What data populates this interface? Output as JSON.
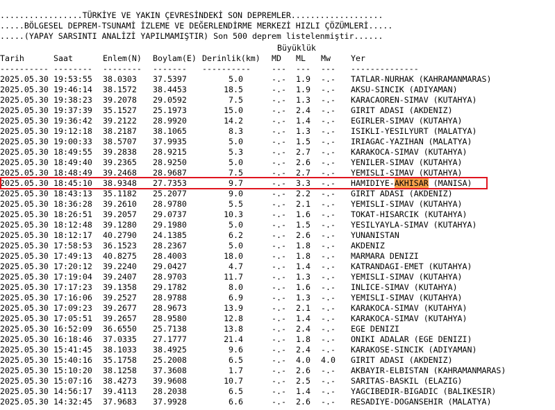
{
  "header": {
    "line1": ".................TÜRKİYE VE YAKIN ÇEVRESİNDEKİ SON DEPREMLER...................",
    "line2": ".....BÖLGESEL DEPREM-TSUNAMİ İZLEME VE DEĞERLENDİRME MERKEZİ HIZLI ÇÖZÜMLERİ.....",
    "line3": ".....(YAPAY SARSINTI ANALİZİ YAPILMAMIŞTIR) Son 500 deprem listelenmiştir......"
  },
  "columns": {
    "magnitude_group": "Büyüklük",
    "date": "Tarih",
    "time": "Saat",
    "lat": "Enlem(N)",
    "lon": "Boylam(E)",
    "depth": "Derinlik(km)",
    "md": "MD",
    "ml": "ML",
    "mw": "Mw",
    "place": "Yer"
  },
  "separators": {
    "date": "----------",
    "time": "--------",
    "lat": "--------",
    "lon": "-------",
    "depth": "----------",
    "md": "---",
    "ml": "---",
    "mw": "---",
    "place": "--------------"
  },
  "highlight": {
    "row_index": 10,
    "term": "AKHISAR",
    "mark_color": "#f5a04a",
    "box_color": "#e0141e"
  },
  "rows": [
    {
      "date": "2025.05.30",
      "time": "19:53:55",
      "lat": "38.0303",
      "lon": "37.5397",
      "depth": "5.0",
      "md": "-.-",
      "ml": "1.9",
      "mw": "-.-",
      "place": "TATLAR-NURHAK (KAHRAMANMARAS)"
    },
    {
      "date": "2025.05.30",
      "time": "19:46:14",
      "lat": "38.1572",
      "lon": "38.4453",
      "depth": "18.5",
      "md": "-.-",
      "ml": "1.9",
      "mw": "-.-",
      "place": "AKSU-SINCIK (ADIYAMAN)"
    },
    {
      "date": "2025.05.30",
      "time": "19:38:23",
      "lat": "39.2078",
      "lon": "29.0592",
      "depth": "7.5",
      "md": "-.-",
      "ml": "1.3",
      "mw": "-.-",
      "place": "KARACAOREN-SIMAV (KUTAHYA)"
    },
    {
      "date": "2025.05.30",
      "time": "19:37:39",
      "lat": "35.1527",
      "lon": "25.1973",
      "depth": "15.0",
      "md": "-.-",
      "ml": "2.4",
      "mw": "-.-",
      "place": "GIRIT ADASI (AKDENIZ)"
    },
    {
      "date": "2025.05.30",
      "time": "19:36:42",
      "lat": "39.2122",
      "lon": "28.9920",
      "depth": "14.2",
      "md": "-.-",
      "ml": "1.4",
      "mw": "-.-",
      "place": "EGIRLER-SIMAV (KUTAHYA)"
    },
    {
      "date": "2025.05.30",
      "time": "19:12:18",
      "lat": "38.2187",
      "lon": "38.1065",
      "depth": "8.3",
      "md": "-.-",
      "ml": "1.3",
      "mw": "-.-",
      "place": "ISIKLI-YESILYURT (MALATYA)"
    },
    {
      "date": "2025.05.30",
      "time": "19:00:33",
      "lat": "38.5707",
      "lon": "37.9935",
      "depth": "5.0",
      "md": "-.-",
      "ml": "1.5",
      "mw": "-.-",
      "place": "IRIAGAC-YAZIHAN (MALATYA)"
    },
    {
      "date": "2025.05.30",
      "time": "18:49:55",
      "lat": "39.2838",
      "lon": "28.9215",
      "depth": "5.3",
      "md": "-.-",
      "ml": "2.7",
      "mw": "-.-",
      "place": "KARAKOCA-SIMAV (KUTAHYA)"
    },
    {
      "date": "2025.05.30",
      "time": "18:49:40",
      "lat": "39.2365",
      "lon": "28.9250",
      "depth": "5.0",
      "md": "-.-",
      "ml": "2.6",
      "mw": "-.-",
      "place": "YENILER-SIMAV (KUTAHYA)"
    },
    {
      "date": "2025.05.30",
      "time": "18:48:49",
      "lat": "39.2468",
      "lon": "28.9687",
      "depth": "7.5",
      "md": "-.-",
      "ml": "2.7",
      "mw": "-.-",
      "place": "YEMISLI-SIMAV (KUTAHYA)"
    },
    {
      "date": "2025.05.30",
      "time": "18:45:10",
      "lat": "38.9348",
      "lon": "27.7353",
      "depth": "9.7",
      "md": "-.-",
      "ml": "3.3",
      "mw": "-.-",
      "place": "HAMIDIYE-AKHISAR (MANISA)"
    },
    {
      "date": "2025.05.30",
      "time": "18:43:13",
      "lat": "35.1182",
      "lon": "25.2077",
      "depth": "9.0",
      "md": "-.-",
      "ml": "2.2",
      "mw": "-.-",
      "place": "GIRIT ADASI (AKDENIZ)"
    },
    {
      "date": "2025.05.30",
      "time": "18:36:28",
      "lat": "39.2610",
      "lon": "28.9780",
      "depth": "5.5",
      "md": "-.-",
      "ml": "2.1",
      "mw": "-.-",
      "place": "YEMISLI-SIMAV (KUTAHYA)"
    },
    {
      "date": "2025.05.30",
      "time": "18:26:51",
      "lat": "39.2057",
      "lon": "29.0737",
      "depth": "10.3",
      "md": "-.-",
      "ml": "1.6",
      "mw": "-.-",
      "place": "TOKAT-HISARCIK (KUTAHYA)"
    },
    {
      "date": "2025.05.30",
      "time": "18:12:48",
      "lat": "39.1280",
      "lon": "29.1980",
      "depth": "5.0",
      "md": "-.-",
      "ml": "1.5",
      "mw": "-.-",
      "place": "YESILYAYLA-SIMAV (KUTAHYA)"
    },
    {
      "date": "2025.05.30",
      "time": "18:12:17",
      "lat": "40.2790",
      "lon": "24.1385",
      "depth": "6.2",
      "md": "-.-",
      "ml": "2.6",
      "mw": "-.-",
      "place": "YUNANISTAN"
    },
    {
      "date": "2025.05.30",
      "time": "17:58:53",
      "lat": "36.1523",
      "lon": "28.2367",
      "depth": "5.0",
      "md": "-.-",
      "ml": "1.8",
      "mw": "-.-",
      "place": "AKDENIZ"
    },
    {
      "date": "2025.05.30",
      "time": "17:49:13",
      "lat": "40.8275",
      "lon": "28.4003",
      "depth": "18.0",
      "md": "-.-",
      "ml": "1.8",
      "mw": "-.-",
      "place": "MARMARA DENIZI"
    },
    {
      "date": "2025.05.30",
      "time": "17:20:12",
      "lat": "39.2240",
      "lon": "29.0427",
      "depth": "4.7",
      "md": "-.-",
      "ml": "1.4",
      "mw": "-.-",
      "place": "KATRANDAGI-EMET (KUTAHYA)"
    },
    {
      "date": "2025.05.30",
      "time": "17:19:04",
      "lat": "39.2407",
      "lon": "28.9703",
      "depth": "11.7",
      "md": "-.-",
      "ml": "1.3",
      "mw": "-.-",
      "place": "YEMISLI-SIMAV (KUTAHYA)"
    },
    {
      "date": "2025.05.30",
      "time": "17:17:23",
      "lat": "39.1358",
      "lon": "29.1782",
      "depth": "8.0",
      "md": "-.-",
      "ml": "1.6",
      "mw": "-.-",
      "place": "INLICE-SIMAV (KUTAHYA)"
    },
    {
      "date": "2025.05.30",
      "time": "17:16:06",
      "lat": "39.2527",
      "lon": "28.9788",
      "depth": "6.9",
      "md": "-.-",
      "ml": "1.3",
      "mw": "-.-",
      "place": "YEMISLI-SIMAV (KUTAHYA)"
    },
    {
      "date": "2025.05.30",
      "time": "17:09:23",
      "lat": "39.2677",
      "lon": "28.9673",
      "depth": "13.9",
      "md": "-.-",
      "ml": "2.1",
      "mw": "-.-",
      "place": "KARAKOCA-SIMAV (KUTAHYA)"
    },
    {
      "date": "2025.05.30",
      "time": "17:05:51",
      "lat": "39.2657",
      "lon": "28.9580",
      "depth": "12.8",
      "md": "-.-",
      "ml": "1.4",
      "mw": "-.-",
      "place": "KARAKOCA-SIMAV (KUTAHYA)"
    },
    {
      "date": "2025.05.30",
      "time": "16:52:09",
      "lat": "36.6550",
      "lon": "25.7138",
      "depth": "13.8",
      "md": "-.-",
      "ml": "2.4",
      "mw": "-.-",
      "place": "EGE DENIZI"
    },
    {
      "date": "2025.05.30",
      "time": "16:18:46",
      "lat": "37.0335",
      "lon": "27.1777",
      "depth": "21.4",
      "md": "-.-",
      "ml": "1.8",
      "mw": "-.-",
      "place": "ONIKI ADALAR (EGE DENIZI)"
    },
    {
      "date": "2025.05.30",
      "time": "15:41:45",
      "lat": "38.1033",
      "lon": "38.4925",
      "depth": "9.6",
      "md": "-.-",
      "ml": "2.4",
      "mw": "-.-",
      "place": "KARAKOSE-SINCIK (ADIYAMAN)"
    },
    {
      "date": "2025.05.30",
      "time": "15:40:16",
      "lat": "35.1758",
      "lon": "25.2008",
      "depth": "6.5",
      "md": "-.-",
      "ml": "4.0",
      "mw": "4.0",
      "place": "GIRIT ADASI (AKDENIZ)"
    },
    {
      "date": "2025.05.30",
      "time": "15:10:20",
      "lat": "38.1258",
      "lon": "37.3608",
      "depth": "1.7",
      "md": "-.-",
      "ml": "2.6",
      "mw": "-.-",
      "place": "AKBAYIR-ELBISTAN (KAHRAMANMARAS)"
    },
    {
      "date": "2025.05.30",
      "time": "15:07:16",
      "lat": "38.4273",
      "lon": "39.9608",
      "depth": "10.7",
      "md": "-.-",
      "ml": "2.5",
      "mw": "-.-",
      "place": "SARITAS-BASKIL (ELAZIG)"
    },
    {
      "date": "2025.05.30",
      "time": "14:56:17",
      "lat": "39.4113",
      "lon": "28.2038",
      "depth": "6.5",
      "md": "-.-",
      "ml": "1.4",
      "mw": "-.-",
      "place": "YAGCIBEDIR-BIGADIC (BALIKESIR)"
    },
    {
      "date": "2025.05.30",
      "time": "14:32:45",
      "lat": "37.9683",
      "lon": "37.9928",
      "depth": "6.6",
      "md": "-.-",
      "ml": "2.6",
      "mw": "-.-",
      "place": "RESADIYE-DOGANSEHIR (MALATYA)"
    }
  ]
}
